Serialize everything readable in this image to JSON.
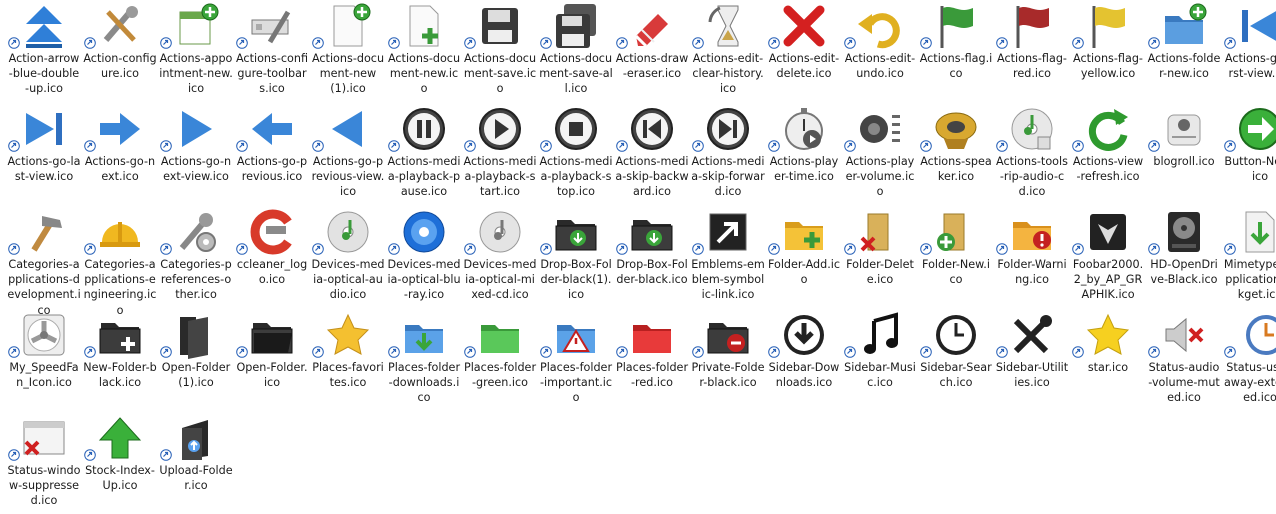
{
  "overlay_icon": "shortcut-arrow-icon",
  "files": [
    {
      "name": "Action-arrow-blue-double-up.ico",
      "icon": "arrow-double-up-blue"
    },
    {
      "name": "Action-configure.ico",
      "icon": "tools-configure"
    },
    {
      "name": "Actions-appointment-new.ico",
      "icon": "appointment-new"
    },
    {
      "name": "Actions-configure-toolbars.ico",
      "icon": "configure-toolbars"
    },
    {
      "name": "Actions-document-new(1).ico",
      "icon": "document-new-green-badge"
    },
    {
      "name": "Actions-document-new.ico",
      "icon": "document-new-plus"
    },
    {
      "name": "Actions-document-save.ico",
      "icon": "floppy-save"
    },
    {
      "name": "Actions-document-save-all.ico",
      "icon": "floppy-save-all"
    },
    {
      "name": "Actions-draw-eraser.ico",
      "icon": "eraser"
    },
    {
      "name": "Actions-edit-clear-history.ico",
      "icon": "hourglass-clear-history"
    },
    {
      "name": "Actions-edit-delete.ico",
      "icon": "delete-red-x"
    },
    {
      "name": "Actions-edit-undo.ico",
      "icon": "undo-arrow"
    },
    {
      "name": "Actions-flag.ico",
      "icon": "flag-green"
    },
    {
      "name": "Actions-flag-red.ico",
      "icon": "flag-red"
    },
    {
      "name": "Actions-flag-yellow.ico",
      "icon": "flag-yellow"
    },
    {
      "name": "Actions-folder-new.ico",
      "icon": "folder-new-blue"
    },
    {
      "name": "Actions-go-first-view.ico",
      "icon": "go-first-view"
    },
    {
      "name": "Actions-go-last-view.ico",
      "icon": "go-last-view"
    },
    {
      "name": "Actions-go-next.ico",
      "icon": "arrow-next-blue"
    },
    {
      "name": "Actions-go-next-view.ico",
      "icon": "triangle-next-blue"
    },
    {
      "name": "Actions-go-previous.ico",
      "icon": "arrow-previous-blue"
    },
    {
      "name": "Actions-go-previous-view.ico",
      "icon": "triangle-previous-blue"
    },
    {
      "name": "Actions-media-playback-pause.ico",
      "icon": "media-pause"
    },
    {
      "name": "Actions-media-playback-start.ico",
      "icon": "media-play"
    },
    {
      "name": "Actions-media-playback-stop.ico",
      "icon": "media-stop"
    },
    {
      "name": "Actions-media-skip-backward.ico",
      "icon": "media-skip-backward"
    },
    {
      "name": "Actions-media-skip-forward.ico",
      "icon": "media-skip-forward"
    },
    {
      "name": "Actions-player-time.ico",
      "icon": "stopwatch"
    },
    {
      "name": "Actions-player-volume.ico",
      "icon": "speaker-volume"
    },
    {
      "name": "Actions-speaker.ico",
      "icon": "speaker-gold"
    },
    {
      "name": "Actions-tools-rip-audio-cd.ico",
      "icon": "rip-audio-cd"
    },
    {
      "name": "Actions-view-refresh.ico",
      "icon": "refresh-green"
    },
    {
      "name": "blogroll.ico",
      "icon": "blogroll-paper"
    },
    {
      "name": "Button-Next.ico",
      "icon": "button-next-green"
    },
    {
      "name": "Categories-applications-development.ico",
      "icon": "hammer"
    },
    {
      "name": "Categories-applications-engineering.ico",
      "icon": "hard-hat"
    },
    {
      "name": "Categories-preferences-other.ico",
      "icon": "wrench-gear"
    },
    {
      "name": "ccleaner_logo.ico",
      "icon": "ccleaner-logo"
    },
    {
      "name": "Devices-media-optical-audio.ico",
      "icon": "cd-audio"
    },
    {
      "name": "Devices-media-optical-blu-ray.ico",
      "icon": "blu-ray-disc"
    },
    {
      "name": "Devices-media-optical-mixed-cd.ico",
      "icon": "cd-mixed"
    },
    {
      "name": "Drop-Box-Folder-black(1).ico",
      "icon": "dropbox-folder-black"
    },
    {
      "name": "Drop-Box-Folder-black.ico",
      "icon": "dropbox-folder-black"
    },
    {
      "name": "Emblems-emblem-symbolic-link.ico",
      "icon": "symbolic-link"
    },
    {
      "name": "Folder-Add.ico",
      "icon": "folder-add"
    },
    {
      "name": "Folder-Delete.ico",
      "icon": "folder-delete"
    },
    {
      "name": "Folder-New.ico",
      "icon": "folder-new-green"
    },
    {
      "name": "Folder-Warning.ico",
      "icon": "folder-warning"
    },
    {
      "name": "Foobar2000.2_by_AP_GRAPHIK.ico",
      "icon": "foobar-logo"
    },
    {
      "name": "HD-OpenDrive-Black.ico",
      "icon": "hard-drive-black"
    },
    {
      "name": "Mimetypes-application-x-kget.ico",
      "icon": "kget-download"
    },
    {
      "name": "My_SpeedFan_Icon.ico",
      "icon": "fan"
    },
    {
      "name": "New-Folder-black.ico",
      "icon": "new-folder-black"
    },
    {
      "name": "Open-Folder(1).ico",
      "icon": "open-folder-black"
    },
    {
      "name": "Open-Folder.ico",
      "icon": "open-folder-black-2"
    },
    {
      "name": "Places-favorites.ico",
      "icon": "star-favorites"
    },
    {
      "name": "Places-folder-downloads.ico",
      "icon": "folder-downloads"
    },
    {
      "name": "Places-folder-green.ico",
      "icon": "folder-green"
    },
    {
      "name": "Places-folder-important.ico",
      "icon": "folder-important"
    },
    {
      "name": "Places-folder-red.ico",
      "icon": "folder-red"
    },
    {
      "name": "Private-Folder-black.ico",
      "icon": "private-folder-black"
    },
    {
      "name": "Sidebar-Downloads.ico",
      "icon": "downloads-circle"
    },
    {
      "name": "Sidebar-Music.ico",
      "icon": "music-note"
    },
    {
      "name": "Sidebar-Search.ico",
      "icon": "clock-search"
    },
    {
      "name": "Sidebar-Utilities.ico",
      "icon": "utilities-tools"
    },
    {
      "name": "star.ico",
      "icon": "star-yellow"
    },
    {
      "name": "Status-audio-volume-muted.ico",
      "icon": "volume-muted"
    },
    {
      "name": "Status-user-away-extended.ico",
      "icon": "user-away-clock"
    },
    {
      "name": "Status-window-suppressed.ico",
      "icon": "window-suppressed"
    },
    {
      "name": "Stock-Index-Up.ico",
      "icon": "arrow-up-green"
    },
    {
      "name": "Upload-Folder.ico",
      "icon": "upload-folder"
    }
  ]
}
